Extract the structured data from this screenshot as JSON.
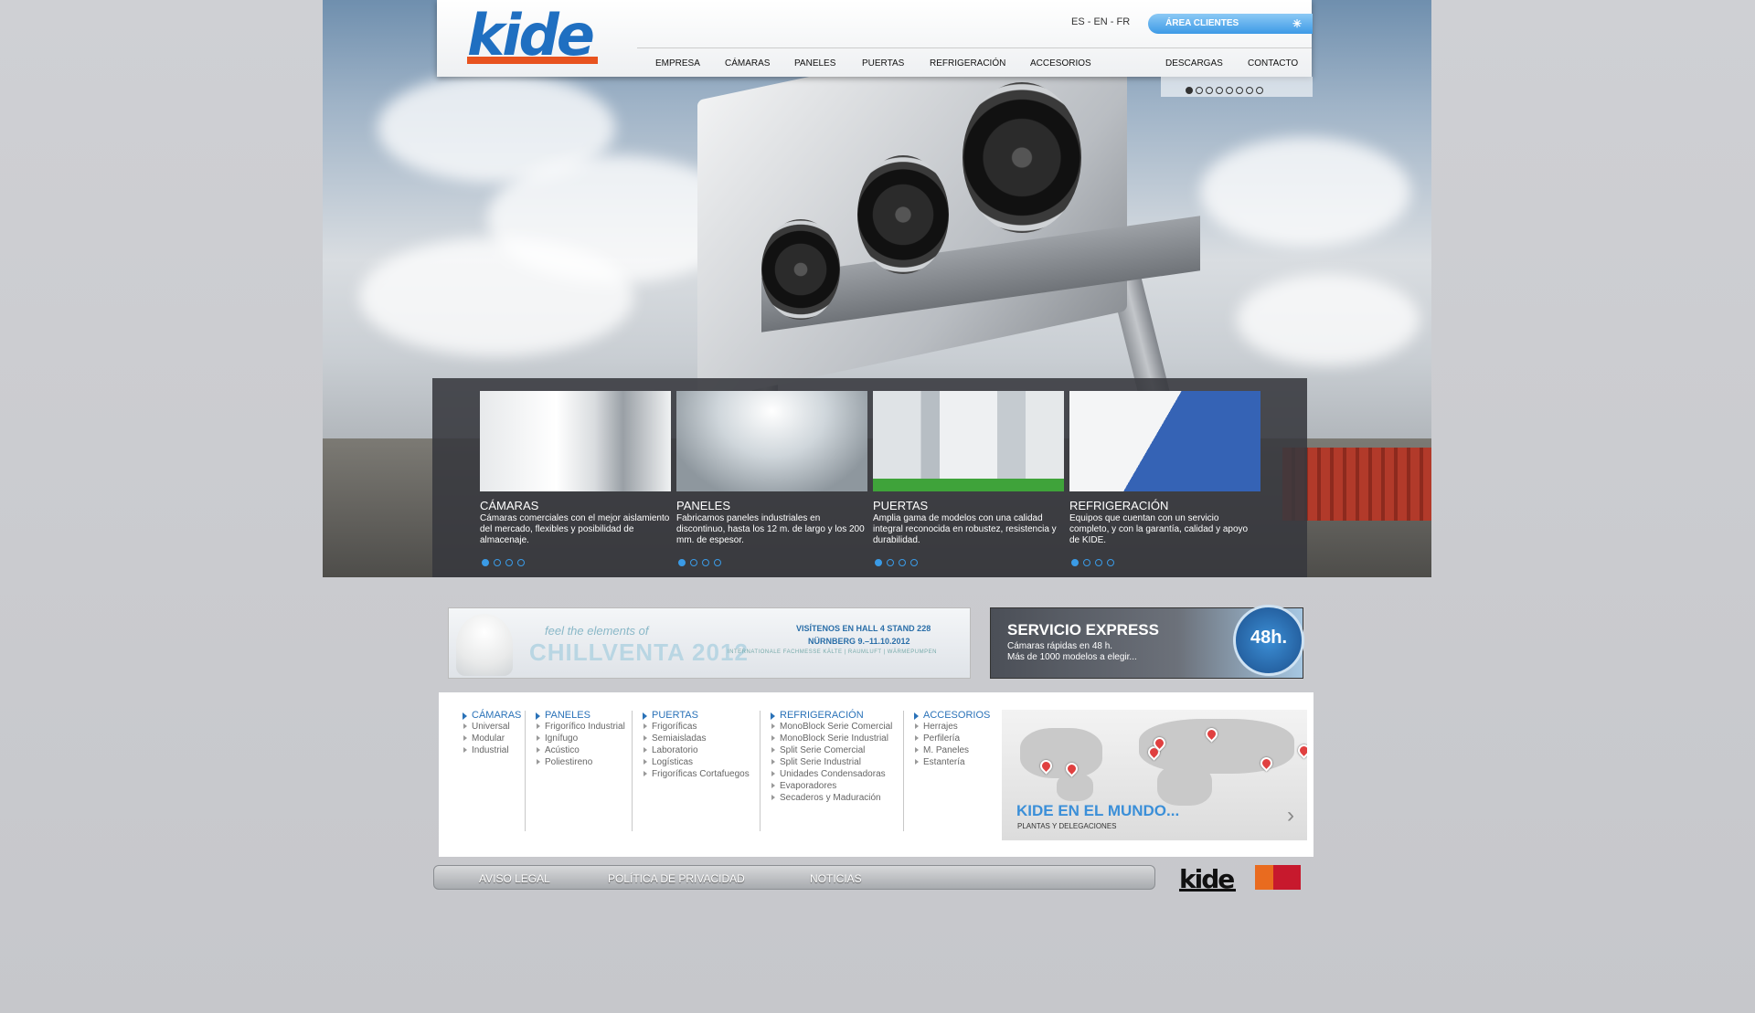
{
  "brand": {
    "logo_text": "kide",
    "colors": {
      "blue": "#1f6fc1",
      "orange": "#e8531f",
      "accent": "#3a9be6"
    }
  },
  "header": {
    "languages": "ES - EN - FR",
    "client_area": "ÁREA CLIENTES",
    "nav": [
      "EMPRESA",
      "CÁMARAS",
      "PANELES",
      "PUERTAS",
      "REFRIGERACIÓN",
      "ACCESORIOS",
      "DESCARGAS",
      "CONTACTO"
    ],
    "slider_current": 1,
    "slider_total": 8
  },
  "cards": [
    {
      "title": "CÁMARAS",
      "desc": "Cámaras comerciales con el mejor aislamiento del mercado, flexibles y posibilidad de almacenaje.",
      "current": 1,
      "total": 4
    },
    {
      "title": "PANELES",
      "desc": "Fabricamos paneles industriales en discontinuo, hasta los 12 m. de largo y los 200 mm. de espesor.",
      "current": 1,
      "total": 4
    },
    {
      "title": "PUERTAS",
      "desc": "Amplia gama de modelos con una calidad integral reconocida en robustez, resistencia y durabilidad.",
      "current": 1,
      "total": 4
    },
    {
      "title": "REFRIGERACIÓN",
      "desc": "Equipos que cuentan con un servicio completo, y con la garantía, calidad y apoyo de KIDE.",
      "current": 1,
      "total": 4
    }
  ],
  "banners": {
    "chillventa": {
      "line1": "feel the elements of",
      "line2": "CHILLVENTA 2012",
      "r1": "VISÍTENOS EN HALL 4 STAND 228",
      "r2": "NÜRNBERG 9.–11.10.2012",
      "r3": "INTERNATIONALE FACHMESSE  KÄLTE | RAUMLUFT | WÄRMEPUMPEN"
    },
    "express": {
      "title": "SERVICIO EXPRESS",
      "sub1": "Cámaras rápidas en 48 h.",
      "sub2": "Más de 1000 modelos a elegir...",
      "badge": "48h."
    }
  },
  "links": {
    "columns": [
      {
        "head": "CÁMARAS",
        "items": [
          "Universal",
          "Modular",
          "Industrial"
        ]
      },
      {
        "head": "PANELES",
        "items": [
          "Frigorífico Industrial",
          "Ignífugo",
          "Acústico",
          "Poliestireno"
        ]
      },
      {
        "head": "PUERTAS",
        "items": [
          "Frigoríficas",
          "Semiaisladas",
          "Laboratorio",
          "Logísticas",
          "Frigoríficas Cortafuegos"
        ]
      },
      {
        "head": "REFRIGERACIÓN",
        "items": [
          "MonoBlock Serie Comercial",
          "MonoBlock Serie Industrial",
          "Split Serie Comercial",
          "Split Serie Industrial",
          "Unidades Condensadoras",
          "Evaporadores",
          "Secaderos y Maduración"
        ]
      },
      {
        "head": "ACCESORIOS",
        "items": [
          "Herrajes",
          "Perfilería",
          "M. Paneles",
          "Estantería"
        ]
      }
    ],
    "map": {
      "title": "KIDE EN EL MUNDO...",
      "subtitle": "PLANTAS Y DELEGACIONES"
    }
  },
  "footer": {
    "links": [
      "AVISO LEGAL",
      "POLÍTICA DE PRIVACIDAD",
      "NOTICIAS"
    ],
    "logo_text": "kide"
  }
}
